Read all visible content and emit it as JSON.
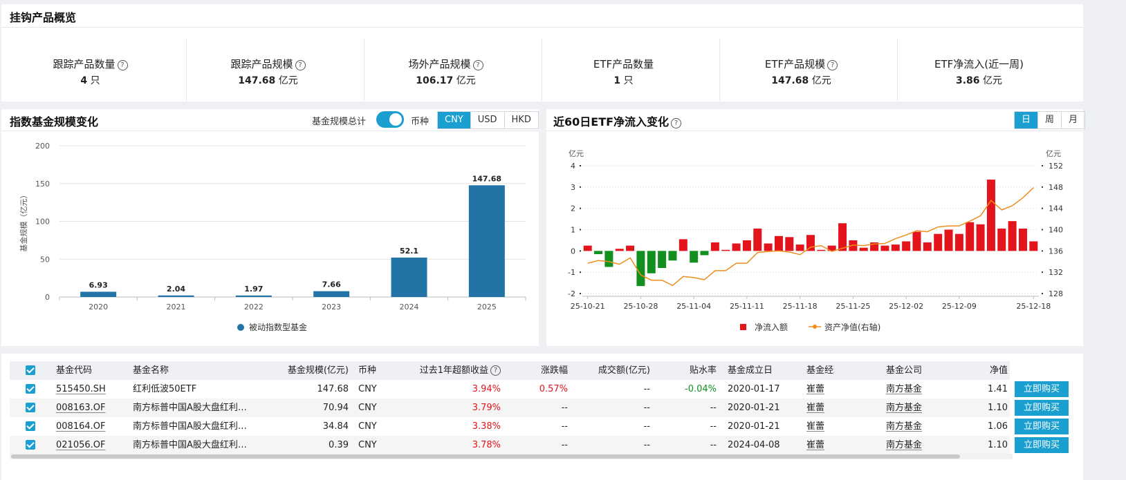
{
  "overview": {
    "title": "挂钩产品概览",
    "cards": [
      {
        "label": "跟踪产品数量",
        "help": true,
        "value": "4",
        "unit": "只"
      },
      {
        "label": "跟踪产品规模",
        "help": true,
        "value": "147.68",
        "unit": "亿元"
      },
      {
        "label": "场外产品规模",
        "help": true,
        "value": "106.17",
        "unit": "亿元"
      },
      {
        "label": "ETF产品数量",
        "help": false,
        "value": "1",
        "unit": "只"
      },
      {
        "label": "ETF产品规模",
        "help": true,
        "value": "147.68",
        "unit": "亿元"
      },
      {
        "label": "ETF净流入(近一周)",
        "help": false,
        "value": "3.86",
        "unit": "亿元"
      }
    ]
  },
  "scale_panel": {
    "title": "指数基金规模变化",
    "total_label": "基金规模总计",
    "currency_label": "币种",
    "currencies": [
      "CNY",
      "USD",
      "HKD"
    ],
    "active_currency": "CNY"
  },
  "flow_panel": {
    "title": "近60日ETF净流入变化",
    "periods": [
      "日",
      "周",
      "月"
    ],
    "active_period": "日"
  },
  "chart_data": [
    {
      "type": "bar",
      "categories": [
        "2020",
        "2021",
        "2022",
        "2023",
        "2024",
        "2025"
      ],
      "series": [
        {
          "name": "被动指数型基金",
          "values": [
            6.93,
            2.04,
            1.97,
            7.66,
            52.1,
            147.68
          ]
        }
      ],
      "ylabel": "基金规模（亿元）",
      "ylim": [
        0,
        200
      ],
      "yticks": [
        0,
        50,
        100,
        150,
        200
      ],
      "data_labels": [
        "6.93",
        "2.04",
        "1.97",
        "7.66",
        "52.1",
        "147.68"
      ],
      "legend": "bottom",
      "color": "#2374a6"
    },
    {
      "type": "bar+line",
      "left_unit": "亿元",
      "right_unit": "亿元",
      "ylim_left": [
        -2,
        4
      ],
      "yticks_left": [
        -2,
        -1,
        0,
        1,
        2,
        3,
        4
      ],
      "ylim_right": [
        128,
        152
      ],
      "yticks_right": [
        128,
        132,
        136,
        140,
        144,
        148,
        152
      ],
      "xtick_labels": [
        "25-10-21",
        "25-10-28",
        "25-11-04",
        "25-11-11",
        "25-11-18",
        "25-11-25",
        "25-12-02",
        "25-12-09",
        "25-12-18"
      ],
      "xtick_positions": [
        0,
        5,
        10,
        15,
        20,
        25,
        30,
        35,
        42
      ],
      "net_inflow": [
        0.25,
        -0.15,
        -0.75,
        0.1,
        0.25,
        -1.65,
        -1.05,
        -0.8,
        -0.45,
        0.55,
        -0.55,
        -0.2,
        0.4,
        0.05,
        0.35,
        0.5,
        1.05,
        0.35,
        0.7,
        0.65,
        0.3,
        0.75,
        0.05,
        0.25,
        1.3,
        0.5,
        0.15,
        0.4,
        0.25,
        0.3,
        0.45,
        0.9,
        0.4,
        0.8,
        1.0,
        0.8,
        1.35,
        1.25,
        3.35,
        1.05,
        1.4,
        1.05,
        0.45
      ],
      "nav": [
        133.7,
        134.2,
        134.0,
        133.5,
        134.7,
        131.5,
        130.5,
        130.5,
        129.5,
        131.2,
        131.0,
        130.6,
        132.3,
        132.3,
        133.7,
        133.7,
        135.7,
        135.9,
        136.0,
        135.8,
        135.3,
        136.7,
        137.0,
        135.9,
        136.5,
        137.1,
        137.0,
        137.3,
        137.4,
        138.3,
        139.0,
        139.8,
        139.6,
        140.5,
        140.7,
        140.7,
        141.6,
        142.6,
        145.5,
        143.7,
        144.5,
        146.0,
        147.9
      ],
      "legend": [
        "净流入额",
        "资产净值(右轴)"
      ],
      "colors": {
        "positive": "#e4141c",
        "negative": "#11901f",
        "line": "#f08c1c"
      }
    }
  ],
  "table": {
    "headers": [
      "基金代码",
      "基金名称",
      "基金规模(亿元)",
      "币种",
      "过去1年超额收益",
      "涨跌幅",
      "成交额(亿元)",
      "贴水率",
      "基金成立日",
      "基金经理",
      "基金公司",
      "净值"
    ],
    "buy_label": "立即购买",
    "rows": [
      {
        "code": "515450.SH",
        "name": "红利低波50ETF",
        "scale": "147.68",
        "currency": "CNY",
        "excess": "3.94%",
        "change": "0.57%",
        "turnover": "--",
        "discount": "-0.04%",
        "inception": "2020-01-17",
        "manager": "崔蕾",
        "company": "南方基金",
        "nav": "1.41"
      },
      {
        "code": "008163.OF",
        "name": "南方标普中国A股大盘红利…",
        "scale": "70.94",
        "currency": "CNY",
        "excess": "3.79%",
        "change": "--",
        "turnover": "--",
        "discount": "--",
        "inception": "2020-01-21",
        "manager": "崔蕾",
        "company": "南方基金",
        "nav": "1.10"
      },
      {
        "code": "008164.OF",
        "name": "南方标普中国A股大盘红利…",
        "scale": "34.84",
        "currency": "CNY",
        "excess": "3.38%",
        "change": "--",
        "turnover": "--",
        "discount": "--",
        "inception": "2020-01-21",
        "manager": "崔蕾",
        "company": "南方基金",
        "nav": "1.06"
      },
      {
        "code": "021056.OF",
        "name": "南方标普中国A股大盘红利…",
        "scale": "0.39",
        "currency": "CNY",
        "excess": "3.78%",
        "change": "--",
        "turnover": "--",
        "discount": "--",
        "inception": "2024-04-08",
        "manager": "崔蕾",
        "company": "南方基金",
        "nav": "1.10"
      }
    ]
  }
}
